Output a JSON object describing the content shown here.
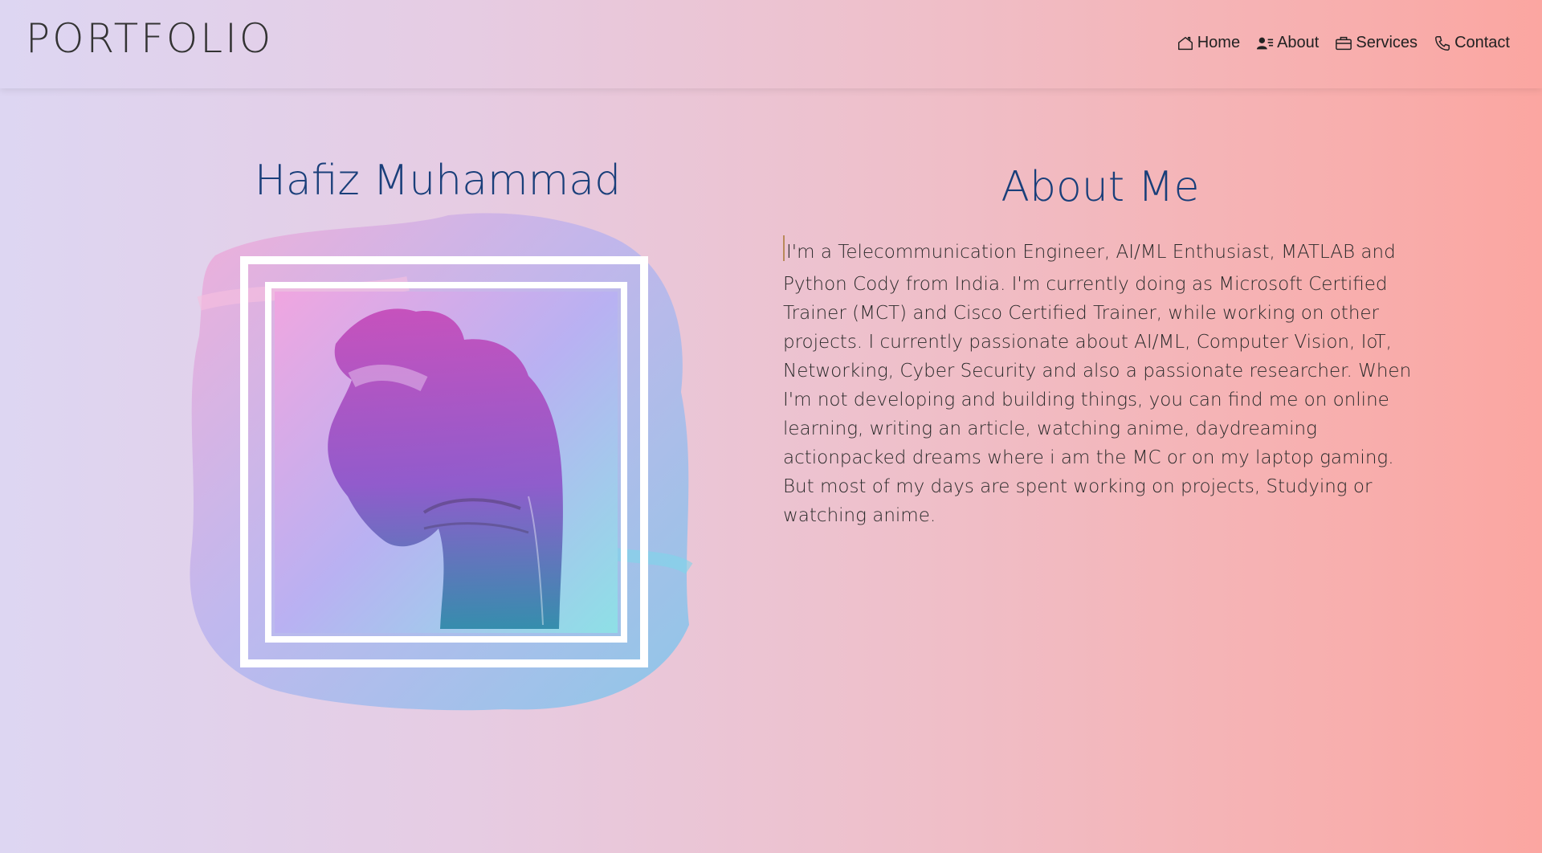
{
  "brand": {
    "logo_text": "PORTFOLIO"
  },
  "nav": {
    "items": [
      {
        "label": "Home",
        "icon": "home-icon"
      },
      {
        "label": "About",
        "icon": "user-details-icon"
      },
      {
        "label": "Services",
        "icon": "briefcase-icon"
      },
      {
        "label": "Contact",
        "icon": "phone-icon"
      }
    ]
  },
  "profile": {
    "name": "Hafiz Muhammad"
  },
  "about": {
    "title": "About Me",
    "first_line": "I'm a Telecommunication Engineer, AI/ML Enthusiast, MATLAB and",
    "body": "Python Cody from India. I'm currently doing as Microsoft Certified Trainer (MCT) and Cisco Certified Trainer, while working on other projects. I currently passionate about AI/ML, Computer Vision, IoT, Networking, Cyber Security and also a passionate researcher. When I'm not developing and building things, you can find me on online learning, writing an article, watching anime, daydreaming actionpacked dreams where i am the MC or on my laptop gaming. But most of my days are spent working on projects, Studying or watching anime."
  },
  "colors": {
    "title": "#1a3f7a",
    "text": "#2a2a2a",
    "gradient_start": "#ddd6f2",
    "gradient_end": "#fba6a1"
  }
}
